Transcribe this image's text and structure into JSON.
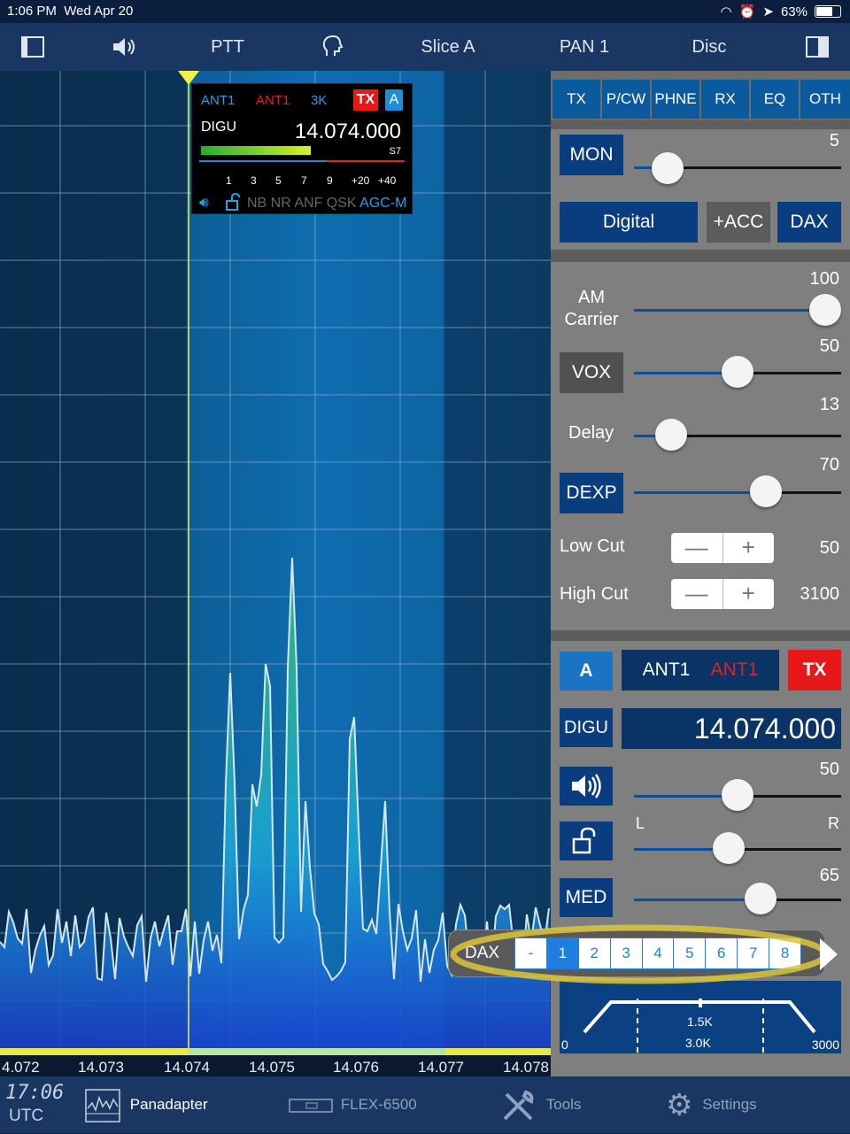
{
  "status": {
    "time": "1:06 PM",
    "date": "Wed Apr 20",
    "battery": "63%"
  },
  "topbar": {
    "ptt": "PTT",
    "slice": "Slice A",
    "pan": "PAN 1",
    "disc": "Disc",
    "icons": [
      "sidebar-left-icon",
      "speaker-icon",
      "voice-icon",
      "sidebar-right-icon"
    ]
  },
  "slice_flag": {
    "rx_ant": "ANT1",
    "tx_ant": "ANT1",
    "bw": "3K",
    "tx": "TX",
    "letter": "A",
    "mode": "DIGU",
    "freq": "14.074.000",
    "s_unit": "S7",
    "scale": [
      "1",
      "3",
      "5",
      "7",
      "9",
      "+20",
      "+40"
    ],
    "features": [
      "NB",
      "NR",
      "ANF",
      "QSK",
      "AGC-M"
    ],
    "signal_level": 0.56
  },
  "freq_labels": [
    "4.072",
    "14.073",
    "14.074",
    "14.075",
    "14.076",
    "14.077",
    "14.078"
  ],
  "tabs": [
    "TX",
    "P/CW",
    "PHNE",
    "RX",
    "EQ",
    "OTH"
  ],
  "tx": {
    "mon_label": "MON",
    "mon_value": "5",
    "mon_level": 0.1,
    "digital": "Digital",
    "acc": "+ACC",
    "dax": "DAX"
  },
  "voice": {
    "am_label": "AM\nCarrier",
    "am_value": "100",
    "am_level": 1.0,
    "vox_label": "VOX",
    "vox_value": "50",
    "vox_level": 0.5,
    "delay_label": "Delay",
    "delay_value": "13",
    "delay_level": 0.12,
    "dexp_label": "DEXP",
    "dexp_value": "70",
    "dexp_level": 0.66,
    "lowcut_label": "Low Cut",
    "lowcut_value": "50",
    "highcut_label": "High Cut",
    "highcut_value": "3100",
    "minus": "—",
    "plus": "+"
  },
  "slice": {
    "letter": "A",
    "rx_ant": "ANT1",
    "tx_ant": "ANT1",
    "tx": "TX",
    "mode": "DIGU",
    "freq": "14.074.000",
    "vol_value": "50",
    "vol_level": 0.5,
    "pan_l": "L",
    "pan_r": "R",
    "pan_level": 0.45,
    "agc_label": "MED",
    "agc_value": "65",
    "agc_level": 0.63
  },
  "dax_popup": {
    "label": "DAX",
    "options": [
      "-",
      "1",
      "2",
      "3",
      "4",
      "5",
      "6",
      "7",
      "8"
    ],
    "selected": "1"
  },
  "filter": {
    "low": "0",
    "high": "3000",
    "center": "1.5K",
    "width": "3.0K"
  },
  "bottombar": {
    "clock": "17:06",
    "zone": "UTC",
    "panadapter": "Panadapter",
    "radio": "FLEX-6500",
    "tools": "Tools",
    "settings": "Settings"
  }
}
